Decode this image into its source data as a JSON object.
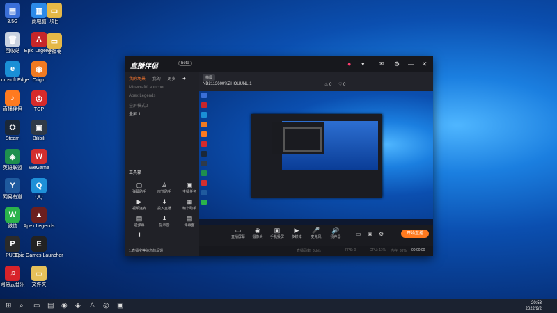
{
  "desktop": {
    "icons": [
      {
        "label": "3.5G",
        "color": "#3a6fd8",
        "glyph": "▤"
      },
      {
        "label": "此电脑",
        "color": "#2c8ae8",
        "glyph": "▥"
      },
      {
        "label": "回收站",
        "color": "#c9d2e0",
        "glyph": "🗑"
      },
      {
        "label": "Epic Legends",
        "color": "#c7262a",
        "glyph": "A"
      },
      {
        "label": "Microsoft Edge",
        "color": "#1a8fd6",
        "glyph": "e"
      },
      {
        "label": "Origin",
        "color": "#f07a22",
        "glyph": "◉"
      },
      {
        "label": "直播伴侣",
        "color": "#ff7a1f",
        "glyph": "♪"
      },
      {
        "label": "TGP",
        "color": "#d62b2b",
        "glyph": "◎"
      },
      {
        "label": "Steam",
        "color": "#1b2838",
        "glyph": "⛭"
      },
      {
        "label": "Bilibili",
        "color": "#2f3a48",
        "glyph": "▣"
      },
      {
        "label": "英雄联盟",
        "color": "#1e8f4e",
        "glyph": "◈"
      },
      {
        "label": "WeGame",
        "color": "#d32f2f",
        "glyph": "W"
      },
      {
        "label": "网易有道",
        "color": "#1f5a9e",
        "glyph": "Y"
      },
      {
        "label": "QQ",
        "color": "#1e90d8",
        "glyph": "Q"
      },
      {
        "label": "微信",
        "color": "#2bb34b",
        "glyph": "W"
      },
      {
        "label": "Apex Legends",
        "color": "#6b1f1f",
        "glyph": "▲"
      },
      {
        "label": "PUBG",
        "color": "#2b2b2b",
        "glyph": "P"
      },
      {
        "label": "Epic Games Launcher",
        "color": "#222",
        "glyph": "E"
      },
      {
        "label": "网易云音乐",
        "color": "#d8232a",
        "glyph": "♫"
      },
      {
        "label": "文件夹",
        "color": "#e6c15a",
        "glyph": "▭"
      }
    ],
    "top_right_icons": [
      {
        "label": "项目",
        "color": "#e5b847",
        "glyph": "▭"
      },
      {
        "label": "文件夹",
        "color": "#e5b847",
        "glyph": "▭"
      }
    ]
  },
  "app": {
    "title": "直播伴侣",
    "badge": "beta",
    "tabs": [
      "我的场景",
      "我的",
      "更多"
    ],
    "scenes": [
      "Minecraft/Launcher",
      "Apex Legends",
      "全屏模式2",
      "全屏 1"
    ],
    "tools_title": "工具箱",
    "tools": [
      {
        "label": "弹幕助手",
        "glyph": "▢"
      },
      {
        "label": "房管助手",
        "glyph": "♙"
      },
      {
        "label": "主播任务",
        "glyph": "▣"
      },
      {
        "label": "视频连麦",
        "glyph": "▶"
      },
      {
        "label": "投入直播",
        "glyph": "⬇"
      },
      {
        "label": "精华助手",
        "glyph": "▦"
      },
      {
        "label": "送弹幕",
        "glyph": "▤"
      },
      {
        "label": "提示音",
        "glyph": "⬇"
      },
      {
        "label": "弹幕面",
        "glyph": "▤"
      },
      {
        "label": "",
        "glyph": "⬇"
      }
    ],
    "notice": "1.直播宝等待您的反馈",
    "preview_pill": "横屏",
    "stream_id": "NB2113600%ZHOUUNLI1",
    "views": "0",
    "likes": "0",
    "controls": [
      {
        "label": "直播屏幕",
        "glyph": "▭"
      },
      {
        "label": "摄像头",
        "glyph": "◉"
      },
      {
        "label": "手机投屏",
        "glyph": "▣"
      },
      {
        "label": "多媒体",
        "glyph": "▶"
      },
      {
        "label": "麦克风",
        "glyph": "🎤"
      },
      {
        "label": "扬声器",
        "glyph": "🔊"
      }
    ],
    "start_button": "开始直播",
    "status": {
      "bitrate": "直播码率: 0kb/s",
      "fps": "FPS: 0",
      "cpu": "CPU: 11%",
      "mem": "内存: 38%",
      "time": "00:00:00"
    }
  },
  "taskbar": {
    "icons": [
      "⊞",
      "⌕",
      "▭",
      "▤",
      "◉",
      "◈",
      "♙",
      "◎",
      "▣"
    ],
    "time": "20:53",
    "date": "2022/9/2"
  }
}
